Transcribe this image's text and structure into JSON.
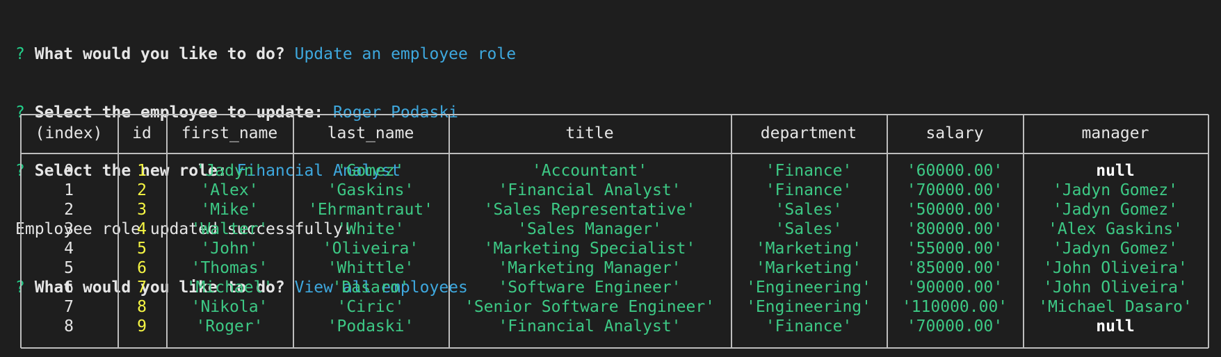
{
  "terminal": {
    "lines": [
      {
        "marker": "?",
        "prompt": "What would you like to do?",
        "answer": "Update an employee role"
      },
      {
        "marker": "?",
        "prompt": "Select the employee to update:",
        "answer": "Roger Podaski"
      },
      {
        "marker": "?",
        "prompt": "Select the new role:",
        "answer": "Financial Analyst"
      },
      {
        "message": "Employee role updated successfully!"
      },
      {
        "marker": "?",
        "prompt": "What would you like to do?",
        "answer": "View all employees"
      }
    ]
  },
  "table": {
    "headers": [
      "(index)",
      "id",
      "first_name",
      "last_name",
      "title",
      "department",
      "salary",
      "manager"
    ],
    "rows": [
      {
        "index": "0",
        "id": "1",
        "first_name": "'Jadyn'",
        "last_name": "'Gomez'",
        "title": "'Accountant'",
        "department": "'Finance'",
        "salary": "'60000.00'",
        "manager": "null"
      },
      {
        "index": "1",
        "id": "2",
        "first_name": "'Alex'",
        "last_name": "'Gaskins'",
        "title": "'Financial Analyst'",
        "department": "'Finance'",
        "salary": "'70000.00'",
        "manager": "'Jadyn Gomez'"
      },
      {
        "index": "2",
        "id": "3",
        "first_name": "'Mike'",
        "last_name": "'Ehrmantraut'",
        "title": "'Sales Representative'",
        "department": "'Sales'",
        "salary": "'50000.00'",
        "manager": "'Jadyn Gomez'"
      },
      {
        "index": "3",
        "id": "4",
        "first_name": "'Walter'",
        "last_name": "'White'",
        "title": "'Sales Manager'",
        "department": "'Sales'",
        "salary": "'80000.00'",
        "manager": "'Alex Gaskins'"
      },
      {
        "index": "4",
        "id": "5",
        "first_name": "'John'",
        "last_name": "'Oliveira'",
        "title": "'Marketing Specialist'",
        "department": "'Marketing'",
        "salary": "'55000.00'",
        "manager": "'Jadyn Gomez'"
      },
      {
        "index": "5",
        "id": "6",
        "first_name": "'Thomas'",
        "last_name": "'Whittle'",
        "title": "'Marketing Manager'",
        "department": "'Marketing'",
        "salary": "'85000.00'",
        "manager": "'John Oliveira'"
      },
      {
        "index": "6",
        "id": "7",
        "first_name": "'Michael'",
        "last_name": "'Dasaro'",
        "title": "'Software Engineer'",
        "department": "'Engineering'",
        "salary": "'90000.00'",
        "manager": "'John Oliveira'"
      },
      {
        "index": "7",
        "id": "8",
        "first_name": "'Nikola'",
        "last_name": "'Ciric'",
        "title": "'Senior Software Engineer'",
        "department": "'Engineering'",
        "salary": "'110000.00'",
        "manager": "'Michael Dasaro'"
      },
      {
        "index": "8",
        "id": "9",
        "first_name": "'Roger'",
        "last_name": "'Podaski'",
        "title": "'Financial Analyst'",
        "department": "'Finance'",
        "salary": "'70000.00'",
        "manager": "null"
      }
    ]
  },
  "colors": {
    "background": "#1e1e1e",
    "prompt_marker": "#23d18b",
    "answer": "#3ea8de",
    "string_value": "#3dc985",
    "number_value": "#f5f543",
    "border": "#bdbdbd"
  }
}
